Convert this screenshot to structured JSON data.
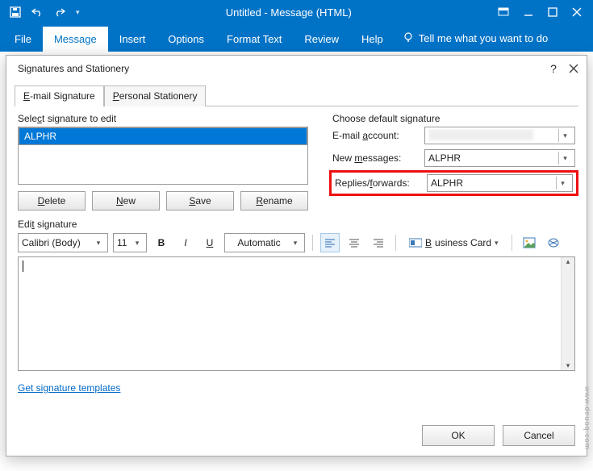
{
  "titlebar": {
    "title": "Untitled - Message (HTML)"
  },
  "ribbon": {
    "file": "File",
    "message": "Message",
    "insert": "Insert",
    "options": "Options",
    "format": "Format Text",
    "review": "Review",
    "help": "Help",
    "tellme": "Tell me what you want to do"
  },
  "dialog": {
    "title": "Signatures and Stationery",
    "tabs": {
      "email": "E-mail Signature",
      "personal": "Personal Stationery"
    },
    "selectLabel": "Select signature to edit",
    "sigSelected": "ALPHR",
    "buttons": {
      "delete": "Delete",
      "new": "New",
      "save": "Save",
      "rename": "Rename"
    },
    "chooseLabel": "Choose default signature",
    "fields": {
      "account": {
        "label": "E-mail account:",
        "value": ""
      },
      "newmsg": {
        "label": "New messages:",
        "value": "ALPHR"
      },
      "replies": {
        "label": "Replies/forwards:",
        "value": "ALPHR"
      }
    },
    "editLabel": "Edit signature",
    "toolbar": {
      "font": "Calibri (Body)",
      "size": "11",
      "color": "Automatic",
      "bizcard": "Business Card"
    },
    "link": "Get signature templates",
    "ok": "OK",
    "cancel": "Cancel"
  },
  "watermark": "www.deuaq.com"
}
